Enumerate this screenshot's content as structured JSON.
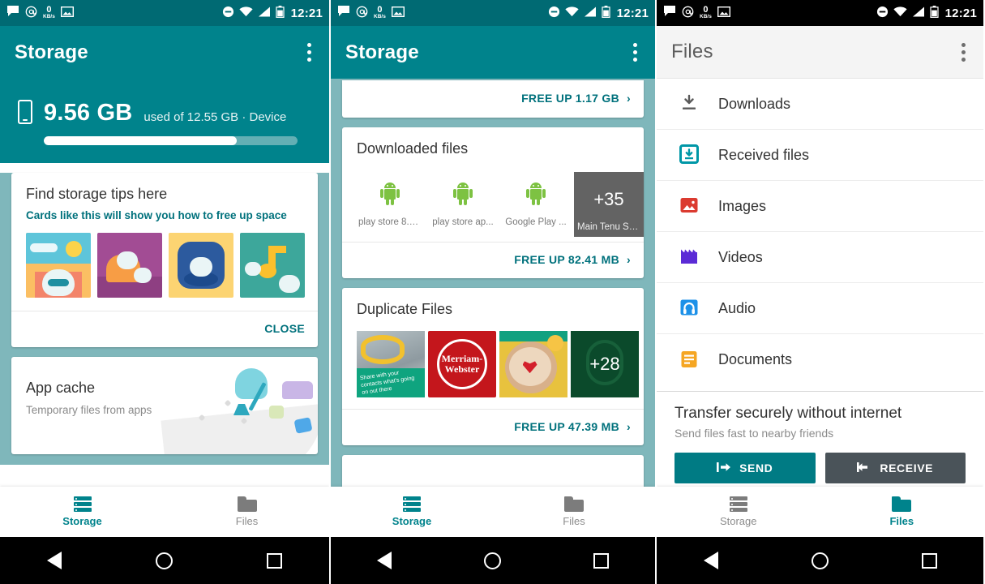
{
  "status_bar": {
    "time": "12:21",
    "left_icons": [
      "message-icon",
      "email-at-icon",
      "network-speed-icon",
      "image-icon"
    ],
    "speed_value": "0",
    "speed_unit": "KB/s",
    "right_icons": [
      "do-not-disturb-icon",
      "wifi-icon",
      "cell-signal-icon",
      "battery-icon"
    ]
  },
  "panel1": {
    "appbar": {
      "title": "Storage",
      "overflow": "more-options"
    },
    "hero": {
      "used": "9.56 GB",
      "detail": "used of 12.55 GB · Device",
      "progress_percent": 76
    },
    "tips_card": {
      "title": "Find storage tips here",
      "subtitle": "Cards like this will show you how to free up space",
      "thumbs": [
        "beach-blob-illustration",
        "sofa-blob-illustration",
        "app-icon-blob-illustration",
        "music-note-blob-illustration"
      ],
      "action": "CLOSE"
    },
    "appcache_card": {
      "title": "App cache",
      "subtitle": "Temporary files from apps"
    },
    "bottom_nav": [
      {
        "label": "Storage",
        "icon": "storage-icon",
        "active": true
      },
      {
        "label": "Files",
        "icon": "folder-icon",
        "active": false
      }
    ]
  },
  "panel2": {
    "appbar": {
      "title": "Storage",
      "overflow": "more-options"
    },
    "partial_card_action": "FREE UP 1.17 GB",
    "downloaded_card": {
      "title": "Downloaded files",
      "items": [
        {
          "label": "play store 8.2...",
          "icon": "android-apk-icon",
          "selected": false
        },
        {
          "label": "play store ap...",
          "icon": "android-apk-icon",
          "selected": false
        },
        {
          "label": "Google Play ...",
          "icon": "android-apk-icon",
          "selected": false
        },
        {
          "label": "Main Tenu Sa...",
          "icon": "more-count-tile",
          "badge": "+35",
          "selected": true
        }
      ],
      "action": "FREE UP 82.41 MB"
    },
    "duplicate_card": {
      "title": "Duplicate Files",
      "items": [
        {
          "label": "photo-thumbnail",
          "badge": ""
        },
        {
          "label": "merriam-webster-thumbnail",
          "badge": "Merriam-Webster"
        },
        {
          "label": "latte-art-thumbnail",
          "badge": ""
        },
        {
          "label": "more-count-tile",
          "badge": "+28"
        }
      ],
      "action": "FREE UP 47.39 MB"
    },
    "bottom_nav": [
      {
        "label": "Storage",
        "icon": "storage-icon",
        "active": true
      },
      {
        "label": "Files",
        "icon": "folder-icon",
        "active": false
      }
    ]
  },
  "panel3": {
    "appbar": {
      "title": "Files",
      "overflow": "more-options"
    },
    "file_rows": [
      {
        "label": "Downloads",
        "icon": "download-icon",
        "color": "#5a5a5a"
      },
      {
        "label": "Received files",
        "icon": "received-files-icon",
        "color": "#0097A7"
      },
      {
        "label": "Images",
        "icon": "image-icon",
        "color": "#DB3B30"
      },
      {
        "label": "Videos",
        "icon": "video-icon",
        "color": "#5B2BD6"
      },
      {
        "label": "Audio",
        "icon": "audio-icon",
        "color": "#1D91E8"
      },
      {
        "label": "Documents",
        "icon": "document-icon",
        "color": "#F5A623"
      }
    ],
    "transfer": {
      "title": "Transfer securely without internet",
      "subtitle": "Send files fast to nearby friends",
      "send_label": "SEND",
      "receive_label": "RECEIVE"
    },
    "bottom_nav": [
      {
        "label": "Storage",
        "icon": "storage-icon",
        "active": false
      },
      {
        "label": "Files",
        "icon": "folder-icon",
        "active": true
      }
    ]
  },
  "system_nav": {
    "back": "back-icon",
    "home": "home-icon",
    "recents": "recents-icon"
  },
  "colors": {
    "teal_primary": "#00838C",
    "teal_dark": "#006A73",
    "teal_link": "#00717c",
    "page_bg": "#7FB7BB"
  }
}
